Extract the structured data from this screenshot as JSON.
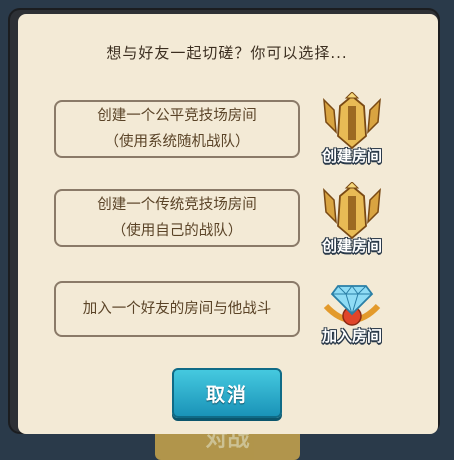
{
  "background_button": {
    "label": "对战"
  },
  "dialog": {
    "title": "想与好友一起切磋？你可以选择...",
    "options": [
      {
        "line1": "创建一个公平竞技场房间",
        "line2": "（使用系统随机战队）",
        "icon_label": "创建房间",
        "icon": "golden-helmet-icon"
      },
      {
        "line1": "创建一个传统竞技场房间",
        "line2": "（使用自己的战队）",
        "icon_label": "创建房间",
        "icon": "golden-helmet-icon"
      },
      {
        "line1": "加入一个好友的房间与他战斗",
        "icon_label": "加入房间",
        "icon": "diamond-orb-icon"
      }
    ],
    "cancel_label": "取消"
  },
  "colors": {
    "panel_bg": "#f3ead6",
    "frame": "#2d3035",
    "text_brown": "#5a4327",
    "cancel_blue": "#1a93b8"
  }
}
